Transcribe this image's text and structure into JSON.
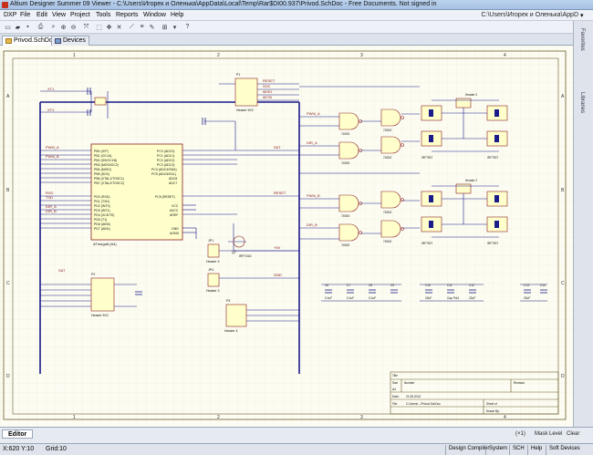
{
  "window": {
    "title": "Altium Designer Summer 09 Viewer - C:\\Users\\Игорек и Оленька\\AppData\\Local\\Temp\\Rar$DI00.937\\Privod.SchDoc - Free Documents. Not signed in"
  },
  "menu": {
    "items": [
      "DXP",
      "File",
      "Edit",
      "View",
      "Project",
      "Tools",
      "Reports",
      "Window",
      "Help"
    ],
    "path": "C:\\Users\\Игорек и Оленька\\AppD",
    "arrow": "▾"
  },
  "tabs": [
    {
      "label": "Privod.SchDoc"
    },
    {
      "label": "Devices"
    }
  ],
  "right_panel": {
    "favorites": "Favorites",
    "libraries": "Libraries"
  },
  "schematic": {
    "ruler_top": [
      "1",
      "2",
      "3",
      "4"
    ],
    "ruler_left": [
      "A",
      "B",
      "C",
      "D"
    ],
    "mcu": {
      "name": "ATmega8 (A4)",
      "left_pins": [
        "PB0 (ICP)",
        "PB1 (OC1A)",
        "PB2 (SS/OC1B)",
        "PB3 (MOSI/OC2)",
        "PB4 (MISO)",
        "PB5 (SCK)",
        "PB6 (XTAL1/TOSC1)",
        "PB7 (XTAL2/TOSC2)",
        "PD0 (RXD)",
        "PD1 (TXD)",
        "PD2 (INT0)",
        "PD3 (INT1)",
        "PD4 (XCK/T0)",
        "PD5 (T1)",
        "PD6 (AIN0)",
        "PD7 (AIN1)"
      ],
      "right_pins": [
        "PC0 (ADC0)",
        "PC1 (ADC1)",
        "PC2 (ADC2)",
        "PC3 (ADC3)",
        "PC4 (ADC4/SDA)",
        "PC5 (ADC5/SCL)",
        "ADC6",
        "ADC7",
        "PC6 (RESET)",
        "VCC",
        "AVCC",
        "AREF",
        "GND",
        "AGND"
      ]
    },
    "header_top": {
      "ref": "P1",
      "name": "Header 5X2"
    },
    "header_left": {
      "ref": "P2",
      "name": "Header 5X2"
    },
    "header_mid": {
      "ref": "JP1",
      "name": "Header 3"
    },
    "header_mid2": {
      "ref": "JP4",
      "name": "Header 3"
    },
    "header_bottom": {
      "ref": "P3",
      "name": "Header 4"
    },
    "transistor": {
      "ref": "Q7",
      "part": "IRF7416"
    },
    "gates": [
      "74S00",
      "74S00",
      "74S00",
      "74S00",
      "74S00",
      "74S00",
      "74S00",
      "74S00"
    ],
    "mosfets": [
      "IRF7907",
      "IRF7907",
      "IRF7907",
      "IRF7907"
    ],
    "headers_right": [
      "Header 2",
      "Header 2"
    ],
    "net_labels": [
      "RESET",
      "SCK",
      "MISO",
      "MOSI",
      "XT1",
      "XT2",
      "RXD",
      "TXD",
      "PWM_A",
      "PWM_B",
      "RESET",
      "SAT",
      "+5V",
      "GND",
      "DIR_A",
      "DIR_B"
    ],
    "caps_bottom": [
      "C6",
      "C7",
      "C8",
      "C9",
      "C10",
      "C11",
      "C12",
      "C13",
      "C14"
    ],
    "cap_values": [
      "0.1uF",
      "0.1uF",
      "0.1uF",
      "22uF",
      "Cap Pol1",
      "22uF",
      "22uF"
    ],
    "title_block": {
      "title_label": "Title",
      "size_label": "Size",
      "size_value": "A4",
      "number_label": "Number",
      "revision_label": "Revision",
      "date_label": "Date:",
      "date_value": "21.08.2013",
      "file_label": "File:",
      "file_value": "C:\\Users\\...\\Privod.SchDoc",
      "sheet_label": "Sheet of",
      "drawn_label": "Drawn By:"
    }
  },
  "editor_bar": {
    "tab": "Editor",
    "zoom": "(×1)",
    "mask": "Mask Level",
    "clear": "Clear"
  },
  "status": {
    "coords": "X:620 Y:10",
    "grid": "Grid:10",
    "buttons": [
      "Design Compiler",
      "System",
      "SCH",
      "Help",
      "Soft Devices"
    ]
  }
}
